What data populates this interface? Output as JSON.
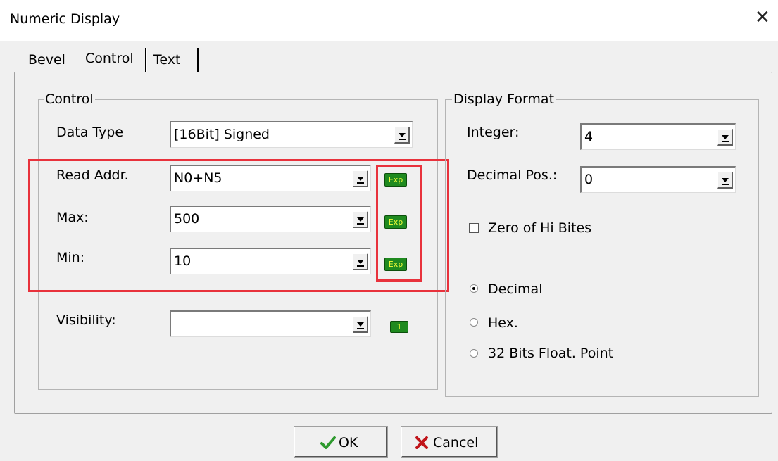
{
  "window": {
    "title": "Numeric Display",
    "close_glyph": "✕"
  },
  "tabs": [
    {
      "label": "Bevel"
    },
    {
      "label": "Control",
      "active": true
    },
    {
      "label": "Text"
    }
  ],
  "control_group": {
    "legend": "Control",
    "data_type": {
      "label": "Data Type",
      "value": "[16Bit] Signed"
    },
    "read_addr": {
      "label": "Read Addr.",
      "value": "N0+N5",
      "icon": "Exp"
    },
    "max": {
      "label": "Max:",
      "value": "500",
      "icon": "Exp"
    },
    "min": {
      "label": "Min:",
      "value": "10",
      "icon": "Exp"
    },
    "visibility": {
      "label": "Visibility:",
      "value": "",
      "icon": "1"
    }
  },
  "display_format": {
    "legend": "Display Format",
    "integer": {
      "label": "Integer:",
      "value": "4"
    },
    "decimal_pos": {
      "label": "Decimal Pos.:",
      "value": "0"
    },
    "zero_hi_bites": {
      "label": "Zero of Hi Bites",
      "checked": false
    },
    "formats": [
      {
        "label": "Decimal",
        "selected": true
      },
      {
        "label": "Hex.",
        "selected": false
      },
      {
        "label": "32 Bits Float. Point",
        "selected": false
      }
    ]
  },
  "buttons": {
    "ok": "OK",
    "cancel": "Cancel"
  },
  "colors": {
    "highlight_box": "#e8323c",
    "exp_icon_bg": "#1f8a1f",
    "exp_icon_text": "#f5ff3a",
    "ok_check": "#2e9a2e",
    "cancel_x": "#c0141a"
  }
}
